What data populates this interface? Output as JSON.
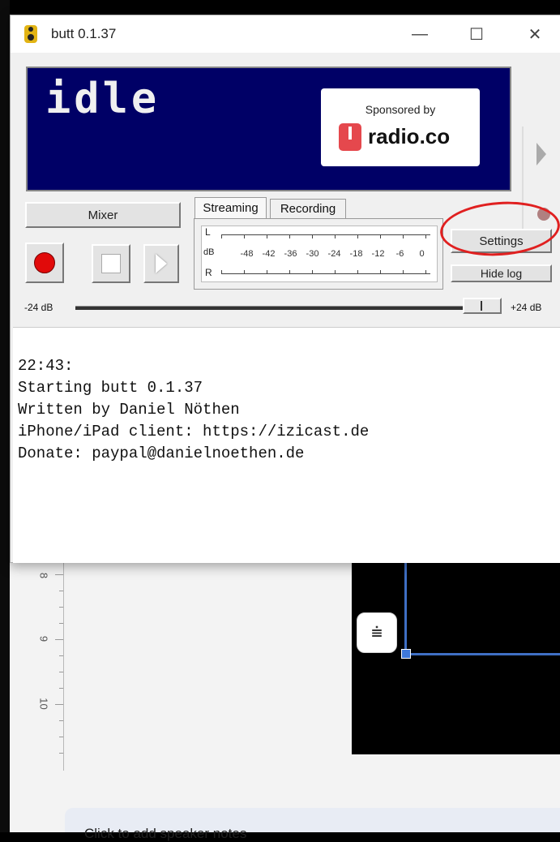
{
  "window": {
    "title": "butt 0.1.37",
    "minimize_glyph": "—",
    "maximize_glyph": "☐",
    "close_glyph": "✕"
  },
  "display": {
    "status": "idle",
    "sponsor_label": "Sponsored by",
    "sponsor_name": "radio.co"
  },
  "controls": {
    "mixer_label": "Mixer",
    "tabs": [
      "Streaming",
      "Recording"
    ],
    "active_tab": "Streaming",
    "settings_label": "Settings",
    "hide_log_label": "Hide log"
  },
  "meter": {
    "left_label": "L",
    "db_label": "dB",
    "right_label": "R",
    "scale": [
      "-48",
      "-42",
      "-36",
      "-30",
      "-24",
      "-18",
      "-12",
      "-6",
      "0"
    ]
  },
  "gain": {
    "min_label": "-24 dB",
    "max_label": "+24 dB",
    "value_fraction": 0.94
  },
  "log": {
    "lines": [
      "22:43:",
      "Starting butt 0.1.37",
      "Written by Daniel Nöthen",
      "iPhone/iPad client: https://izicast.de",
      "Donate: paypal@danielnoethen.de"
    ]
  },
  "background": {
    "ruler_numbers": [
      "8",
      "9",
      "10"
    ],
    "notes_placeholder": "Click to add speaker notes"
  },
  "colors": {
    "display_bg": "#000066",
    "record_red": "#e10a0a",
    "annotation_red": "#e02020",
    "selection_blue": "#3f6fc4"
  }
}
